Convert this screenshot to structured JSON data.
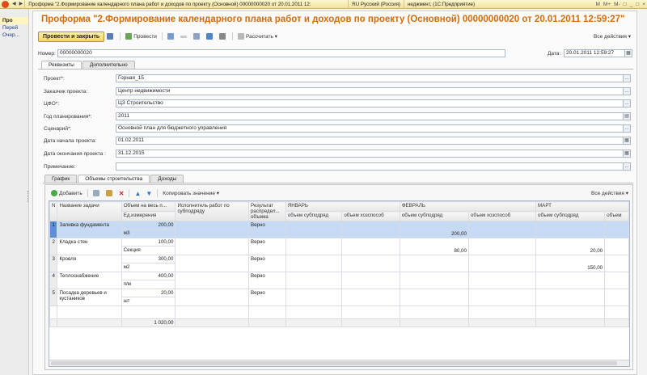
{
  "titlebar": {
    "doc_tab": "Проформа \"2.Формирование календарного плана работ и доходов по проекту (Основной)  00000000020 от 20.01.2011 12:",
    "lang": "RU Русский (Россия)",
    "app": "неджмент,  (1С:Предприятие)",
    "icons": [
      "M",
      "M+",
      "M-",
      "□",
      "_",
      "□",
      "×"
    ]
  },
  "sidebar": {
    "items": [
      "Про",
      "Перей",
      "Очер..."
    ]
  },
  "form": {
    "title": "Проформа \"2.Формирование календарного плана работ и доходов по проекту (Основной)  00000000020 от 20.01.2011 12:59:27\"",
    "toolbar": {
      "post_close": "Провести и закрыть",
      "post": "Провести",
      "calculate": "Рассчитать ▾",
      "all_actions": "Все действия ▾"
    },
    "number_label": "Номер:",
    "number_value": "00000000020",
    "date_label": "Дата:",
    "date_value": "20.01.2011 12:59:27",
    "tabs": [
      "Реквизиты",
      "Дополнительно"
    ],
    "fields": [
      {
        "label": "Проект*:",
        "value": "Горная_15"
      },
      {
        "label": "Заказчик проекта:",
        "value": "Центр недвижимости"
      },
      {
        "label": "ЦФО*:",
        "value": "ЦЗ Строительство"
      },
      {
        "label": "Год планирования*:",
        "value": "2011"
      },
      {
        "label": "Сценарий*:",
        "value": "Основной план для бюджетного управления"
      },
      {
        "label": "Дата начала проекта:",
        "value": "01.02.2011"
      },
      {
        "label": "Дата окончания проекта :",
        "value": "31.12.2015"
      },
      {
        "label": "Примечание:",
        "value": ""
      }
    ]
  },
  "inner": {
    "tabs": [
      "График",
      "Объемы строительства",
      "Доходы"
    ],
    "toolbar": {
      "add": "Добавить",
      "copy_value": "Копировать значение ▾",
      "all_actions": "Все действия ▾"
    },
    "columns": {
      "n": "N",
      "name": "Название задачи",
      "volume": "Объем на весь п...",
      "unit": "Ед.измерения",
      "executor": "Исполнитель работ по субподряду",
      "result": "Результат распредел... объема",
      "jan": "ЯНВАРЬ",
      "feb": "ФЕВРАЛЬ",
      "mar": "МАРТ",
      "sub": "объем субподряд",
      "own": "объем хозспособ",
      "own_short": "объем"
    },
    "rows": [
      {
        "n": "1",
        "name": "Заливка фундамента",
        "volume": "200,00",
        "unit": "м3",
        "result": "Верно",
        "jan_sub": "",
        "jan_own": "",
        "feb_sub": "200,00",
        "feb_own": "",
        "mar_sub": ""
      },
      {
        "n": "2",
        "name": "Кладка стен",
        "volume": "100,00",
        "unit": "Секция",
        "result": "Верно",
        "jan_sub": "",
        "jan_own": "",
        "feb_sub": "80,00",
        "feb_own": "",
        "mar_sub": "20,00"
      },
      {
        "n": "3",
        "name": "Кровля",
        "volume": "300,00",
        "unit": "м2",
        "result": "Верно",
        "jan_sub": "",
        "jan_own": "",
        "feb_sub": "",
        "feb_own": "",
        "mar_sub": "150,00"
      },
      {
        "n": "4",
        "name": "Теплоснабжение",
        "volume": "400,00",
        "unit": "п/м",
        "result": "Верно",
        "jan_sub": "",
        "jan_own": "",
        "feb_sub": "",
        "feb_own": "",
        "mar_sub": ""
      },
      {
        "n": "5",
        "name": "Посадка деревьев и кустаников",
        "volume": "20,00",
        "unit": "шт",
        "result": "Верно",
        "jan_sub": "",
        "jan_own": "",
        "feb_sub": "",
        "feb_own": "",
        "mar_sub": ""
      }
    ],
    "total": "1 020,00"
  }
}
